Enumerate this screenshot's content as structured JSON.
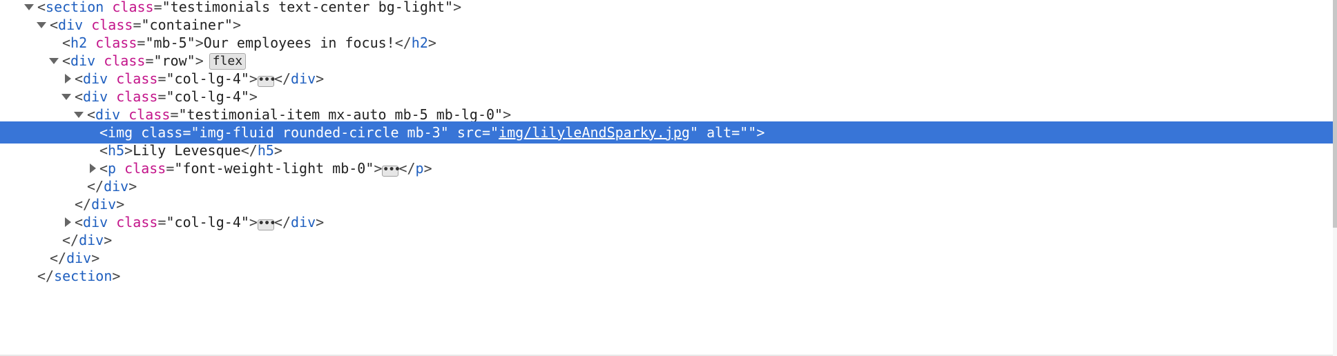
{
  "inspector": {
    "lines": {
      "section_open": {
        "tag": "section",
        "attr": "class",
        "value": "\"testimonials text-center bg-light\""
      },
      "container_open": {
        "tag": "div",
        "attr": "class",
        "value": "\"container\""
      },
      "h2": {
        "tag": "h2",
        "attr": "class",
        "value": "\"mb-5\"",
        "text": "Our employees in focus!"
      },
      "row_open": {
        "tag": "div",
        "attr": "class",
        "value": "\"row\"",
        "badge": "flex"
      },
      "col1": {
        "tag": "div",
        "attr": "class",
        "value": "\"col-lg-4\""
      },
      "col2_open": {
        "tag": "div",
        "attr": "class",
        "value": "\"col-lg-4\""
      },
      "item_open": {
        "tag": "div",
        "attr": "class",
        "value": "\"testimonial-item mx-auto mb-5 mb-lg-0\""
      },
      "img": {
        "tag": "img",
        "attr1": "class",
        "value1": "\"img-fluid rounded-circle mb-3\"",
        "attr2": "src",
        "value2_link": "img/lilyleAndSparky.jpg",
        "attr3": "alt",
        "value3": "\"\""
      },
      "h5": {
        "tag": "h5",
        "text": "Lily Levesque"
      },
      "p": {
        "tag": "p",
        "attr": "class",
        "value": "\"font-weight-light mb-0\""
      },
      "item_close": {
        "tag": "div"
      },
      "col2_close": {
        "tag": "div"
      },
      "col3": {
        "tag": "div",
        "attr": "class",
        "value": "\"col-lg-4\""
      },
      "row_close": {
        "tag": "div"
      },
      "container_close": {
        "tag": "div"
      },
      "section_close": {
        "tag": "section"
      }
    }
  },
  "glyphs": {
    "ellipsis": "•••",
    "lt": "<",
    "gt": ">",
    "lt_slash": "</",
    "eq": "=",
    "quote": "\""
  },
  "colors": {
    "tag": "#1f5fbf",
    "attr": "#c3148a",
    "selection": "#3875d7"
  }
}
